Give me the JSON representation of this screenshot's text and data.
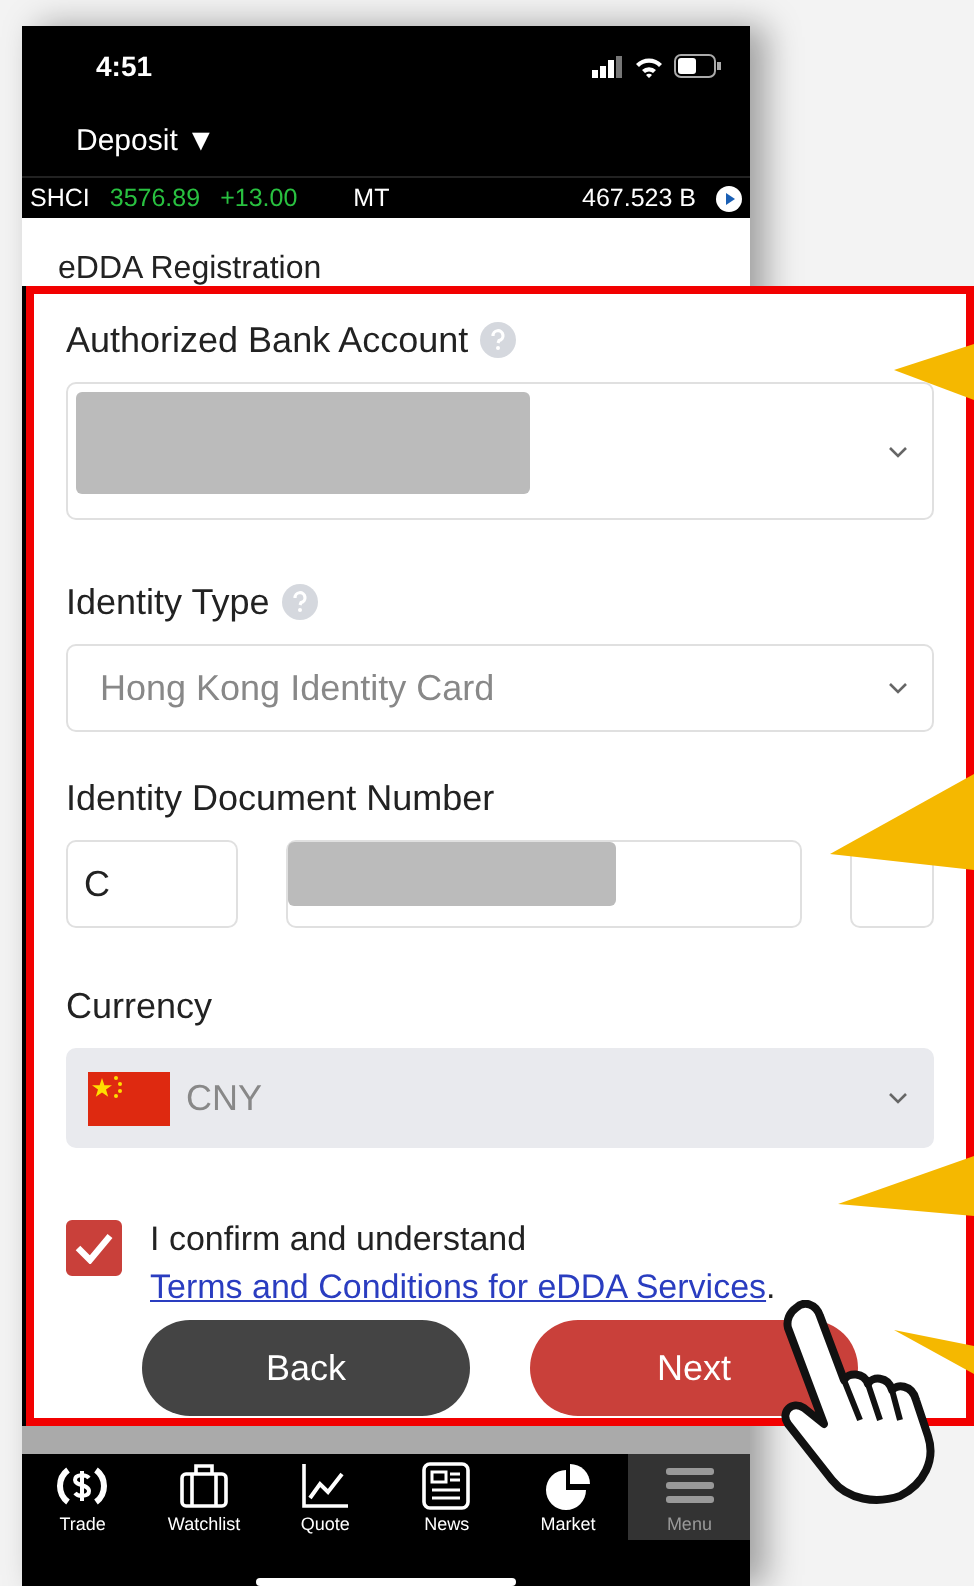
{
  "status_bar": {
    "time": "4:51"
  },
  "header": {
    "title": "Deposit",
    "caret": "▼"
  },
  "ticker": {
    "index": "SHCI",
    "value": "3576.89",
    "change": "+13.00",
    "label": "MT",
    "turnover": "467.523 B"
  },
  "page_title": "eDDA Registration",
  "bank_account": {
    "label": "Authorized Bank Account",
    "help": true,
    "redacted": true
  },
  "identity_type": {
    "label": "Identity Type",
    "help": true,
    "value": "Hong Kong Identity Card"
  },
  "id_number": {
    "label": "Identity Document Number",
    "prefix": "C",
    "redacted": true
  },
  "currency": {
    "label": "Currency",
    "value": "CNY",
    "disabled": true
  },
  "agreement": {
    "checked": true,
    "text": "I confirm and understand ",
    "link": "Terms and Conditions for eDDA Services",
    "end": "."
  },
  "buttons": [
    {
      "label": "Back",
      "kind": "secondary"
    },
    {
      "label": "Next",
      "kind": "primary"
    }
  ],
  "tabs": [
    {
      "label": "Trade",
      "kind": "trade",
      "selected": false
    },
    {
      "label": "Watchlist",
      "kind": "watchlist",
      "selected": false
    },
    {
      "label": "Quote",
      "kind": "quote",
      "selected": false
    },
    {
      "label": "News",
      "kind": "news",
      "selected": false
    },
    {
      "label": "Market",
      "kind": "market",
      "selected": false
    },
    {
      "label": "Menu",
      "kind": "menu",
      "selected": true
    }
  ]
}
